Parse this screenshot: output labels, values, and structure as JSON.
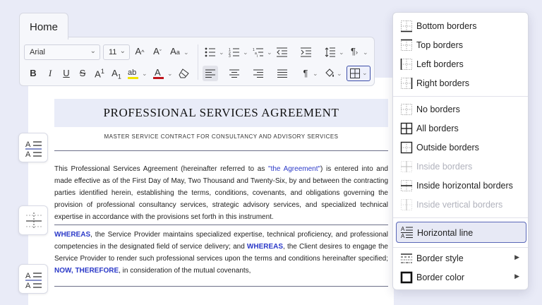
{
  "ribbon": {
    "tab_label": "Home",
    "font_name": "Arial",
    "font_size": "11",
    "icons": [
      "grow-font-icon",
      "shrink-font-icon",
      "change-case-icon",
      "bullets-icon",
      "numbering-icon",
      "multilevel-list-icon",
      "decrease-indent-icon",
      "increase-indent-icon",
      "line-spacing-icon",
      "text-direction-icon",
      "bold-icon",
      "italic-icon",
      "underline-icon",
      "strikethrough-icon",
      "superscript-icon",
      "subscript-icon",
      "highlight-icon",
      "font-color-icon",
      "clear-formatting-icon",
      "align-left-icon",
      "align-center-icon",
      "align-right-icon",
      "justify-icon",
      "paragraph-mark-icon",
      "shading-icon",
      "borders-icon"
    ],
    "highlight_color": "#f2e400",
    "font_color": "#c0141c"
  },
  "document": {
    "title": "PROFESSIONAL SERVICES AGREEMENT",
    "subtitle": "MASTER SERVICE CONTRACT FOR CONSULTANCY AND ADVISORY SERVICES",
    "p1_a": "This Professional Services Agreement (hereinafter referred to as ",
    "p1_q": "\"the Agreement\"",
    "p1_b": ") is entered into and made effective as of the First Day of May, Two Thousand and Twenty-Six, by and between the contracting parties identified herein, establishing the terms, conditions, covenants, and obligations governing the provision of professional consultancy services, strategic advisory services, and specialized technical expertise in accordance with the provisions set forth in this instrument.",
    "p2_whereas1": "WHEREAS",
    "p2_a": ", the Service Provider maintains specialized expertise, technical proficiency, and professional competencies in the designated field of service delivery; and ",
    "p2_whereas2": "WHEREAS",
    "p2_b": ", the Client desires to engage the Service Provider to render such professional services upon the terms and conditions hereinafter specified; ",
    "p2_now": "NOW, THEREFORE",
    "p2_c": ", in consideration of the mutual covenants,"
  },
  "menu": {
    "items": [
      {
        "label": "Bottom borders",
        "icon": "bottom-border-icon"
      },
      {
        "label": "Top borders",
        "icon": "top-border-icon"
      },
      {
        "label": "Left borders",
        "icon": "left-border-icon"
      },
      {
        "label": "Right borders",
        "icon": "right-border-icon"
      },
      {
        "label": "No borders",
        "icon": "no-border-icon"
      },
      {
        "label": "All borders",
        "icon": "all-borders-icon"
      },
      {
        "label": "Outside borders",
        "icon": "outside-borders-icon"
      },
      {
        "label": "Inside borders",
        "icon": "inside-borders-icon",
        "disabled": true
      },
      {
        "label": "Inside horizontal borders",
        "icon": "inside-horizontal-borders-icon"
      },
      {
        "label": "Inside vertical borders",
        "icon": "inside-vertical-borders-icon",
        "disabled": true
      },
      {
        "label": "Horizontal line",
        "icon": "horizontal-line-icon",
        "selected": true
      },
      {
        "label": "Border style",
        "icon": "border-style-icon",
        "submenu": true
      },
      {
        "label": "Border color",
        "icon": "border-color-icon",
        "submenu": true
      }
    ]
  },
  "side_buttons": [
    "horizontal-line-icon",
    "insert-horizontal-rule-icon",
    "horizontal-line-icon"
  ],
  "colors": {
    "accent": "#3d4ea8",
    "link_blue": "#2b39c8"
  }
}
